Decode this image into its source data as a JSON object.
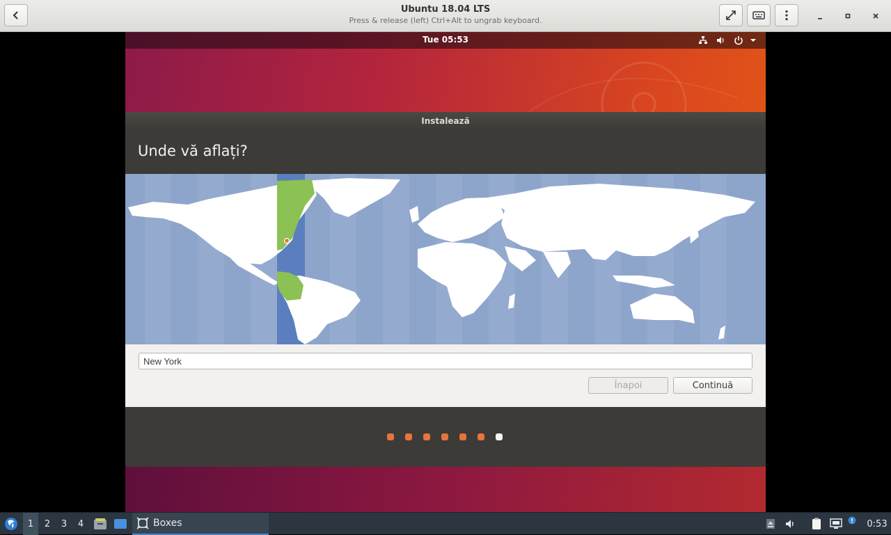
{
  "header": {
    "title": "Ubuntu 18.04 LTS",
    "subtitle": "Press & release (left) Ctrl+Alt to ungrab keyboard.",
    "icons": [
      "back-icon",
      "fullscreen-icon",
      "keyboard-icon",
      "menu-icon",
      "minimize-icon",
      "maximize-icon",
      "close-icon"
    ]
  },
  "vm": {
    "topbar": {
      "clock": "Tue 05:53"
    },
    "installer": {
      "window_title": "Instalează",
      "heading": "Unde vă aflați?",
      "timezone_value": "New York",
      "back_label": "Înapoi",
      "continue_label": "Continuă",
      "progress": {
        "total_steps": 7,
        "current_step": 7
      }
    }
  },
  "taskbar": {
    "desktops": [
      "1",
      "2",
      "3",
      "4"
    ],
    "active_desktop": "1",
    "task_label": "Boxes",
    "clock": "0:53"
  },
  "colors": {
    "installer_bg": "#3c3b37",
    "map_ocean": "#8ea5cb",
    "map_highlight": "#8cc153",
    "progress_dot": "#e8743b",
    "taskbar_bg": "#2b3640"
  }
}
